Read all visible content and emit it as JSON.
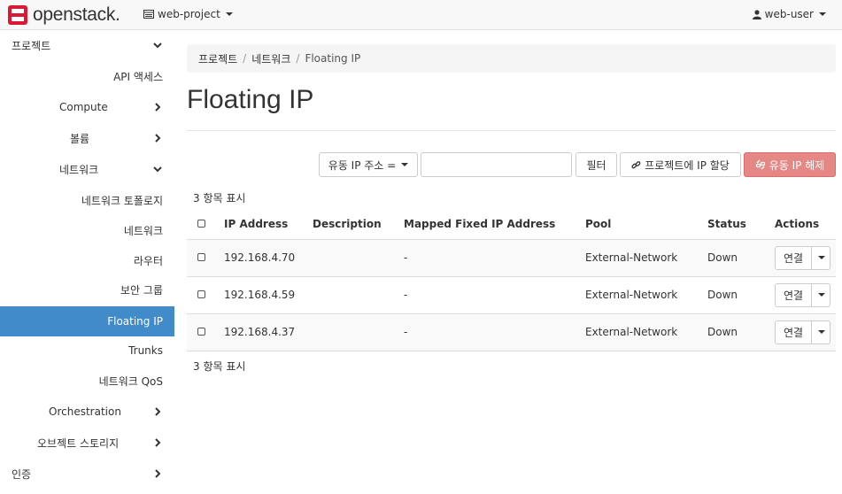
{
  "brand": {
    "name": "openstack.",
    "accent": "#da1a32"
  },
  "header": {
    "project": "web-project",
    "user": "web-user"
  },
  "sidebar": {
    "items": [
      {
        "label": "프로젝트",
        "chevron": "down"
      },
      {
        "label": "API 액세스"
      },
      {
        "label": "Compute",
        "chevron": "right"
      },
      {
        "label": "볼륨",
        "chevron": "right"
      },
      {
        "label": "네트워크",
        "chevron": "down"
      },
      {
        "label": "네트워크 토폴로지"
      },
      {
        "label": "네트워크"
      },
      {
        "label": "라우터"
      },
      {
        "label": "보안 그룹"
      },
      {
        "label": "Floating IP",
        "active": true
      },
      {
        "label": "Trunks"
      },
      {
        "label": "네트워크 QoS"
      },
      {
        "label": "Orchestration",
        "chevron": "right"
      },
      {
        "label": "오브젝트 스토리지",
        "chevron": "right"
      },
      {
        "label": "인증",
        "chevron": "right"
      }
    ],
    "active_color": "#428bca"
  },
  "breadcrumb": {
    "items": [
      "프로젝트",
      "네트워크",
      "Floating IP"
    ]
  },
  "page": {
    "title": "Floating IP"
  },
  "filter": {
    "field_label": "유동 IP 주소 =",
    "input_value": "",
    "filter_button": "필터",
    "allocate_button": "프로젝트에 IP 할당",
    "release_button": "유동 IP 해제",
    "danger_color": "#e48785"
  },
  "table": {
    "count_top": "3 항목 표시",
    "count_bottom": "3 항목 표시",
    "columns": [
      "IP Address",
      "Description",
      "Mapped Fixed IP Address",
      "Pool",
      "Status",
      "Actions"
    ],
    "rows": [
      {
        "ip": "192.168.4.70",
        "description": "",
        "mapped": "-",
        "pool": "External-Network",
        "status": "Down",
        "action": "연결"
      },
      {
        "ip": "192.168.4.59",
        "description": "",
        "mapped": "-",
        "pool": "External-Network",
        "status": "Down",
        "action": "연결"
      },
      {
        "ip": "192.168.4.37",
        "description": "",
        "mapped": "-",
        "pool": "External-Network",
        "status": "Down",
        "action": "연결"
      }
    ]
  }
}
